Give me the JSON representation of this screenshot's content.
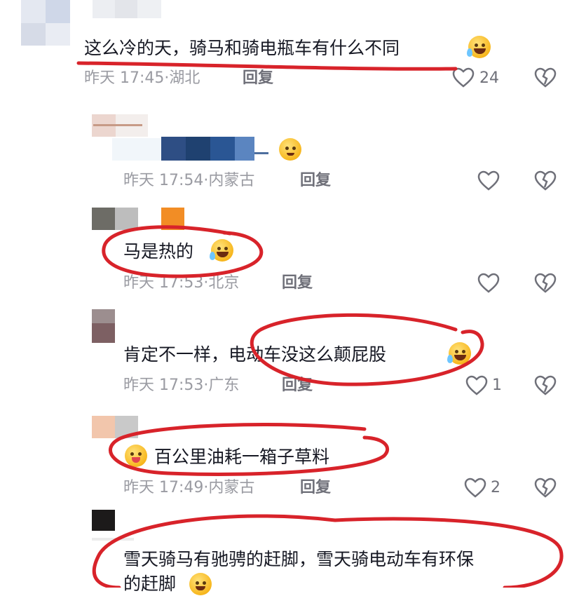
{
  "comments": [
    {
      "text": "这么冷的天，骑马和骑电瓶车有什么不同",
      "time": "昨天 17:45",
      "location": "湖北",
      "reply_label": "回复",
      "likes": "24"
    },
    {
      "text": "",
      "time": "昨天 17:54",
      "location": "内蒙古",
      "reply_label": "回复",
      "likes": ""
    },
    {
      "text": "马是热的",
      "time": "昨天 17:53",
      "location": "北京",
      "reply_label": "回复",
      "likes": ""
    },
    {
      "text": "肯定不一样，电动车没这么颠屁股",
      "time": "昨天 17:53",
      "location": "广东",
      "reply_label": "回复",
      "likes": "1"
    },
    {
      "text": "百公里油耗一箱子草料",
      "time": "昨天 17:49",
      "location": "内蒙古",
      "reply_label": "回复",
      "likes": "2"
    },
    {
      "text_line1": "雪天骑马有驰骋的赶脚，雪天骑电动车有环保",
      "text_line2": "的赶脚"
    }
  ],
  "icons": {
    "like": "heart-outline-icon",
    "dislike": "broken-heart-icon",
    "emoji_laugh_cry": "rofl-emoji",
    "emoji_yummy": "yummy-emoji",
    "emoji_smirk": "sweat-smile-emoji"
  },
  "colors": {
    "annotation": "#d8232a",
    "meta": "#9a9ba2",
    "text": "#161823"
  }
}
